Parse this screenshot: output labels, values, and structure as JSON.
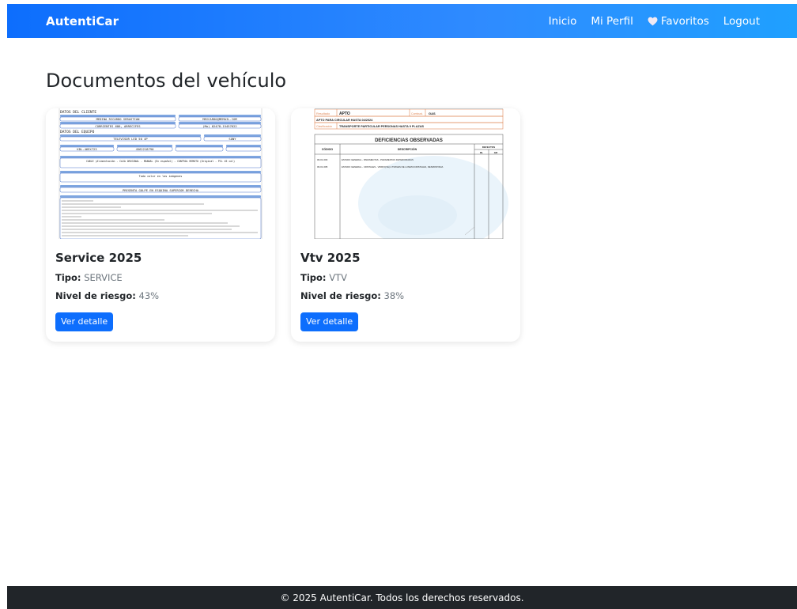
{
  "navbar": {
    "brand": "AutentiCar",
    "links": [
      {
        "label": "Inicio"
      },
      {
        "label": "Mi Perfil"
      },
      {
        "label": "Favoritos"
      },
      {
        "label": "Logout"
      }
    ]
  },
  "page": {
    "title": "Documentos del vehículo"
  },
  "documents": [
    {
      "title": "Service 2025",
      "tipo_label": "Tipo:",
      "tipo": "SERVICE",
      "riesgo_label": "Nivel de riesgo:",
      "riesgo": "43%",
      "button": "Ver detalle",
      "thumb": {
        "section_cliente": "DATOS DEL CLIENTE",
        "cliente_nombre": "MEDINA RICARDO SEBASTIAN",
        "cliente_email": "MRICARDO@MEMAIL.COM",
        "cliente_domicilio": "CORRIENTES 686, ARRECIFES",
        "cliente_telefono": "(Mo) 02478-15457622",
        "section_equipo": "DATOS DEL EQUIPO",
        "equipo_desc": "TELEVISOR LED 50 4P",
        "equipo_marca": "SONY",
        "equipo_modelo": "KDL-46EX723",
        "equipo_serie": "4562218790",
        "accesorios": "CABLE (Alimentación - CAJA ORIGINAL - MANUAL (En español) - CONTROL REMOTO (Original - PIL 45 col)",
        "danos": "Todo color en las imágenes",
        "comentarios": "PRESENTA GOLPE EN ESQUINA SUPERIOR DERECHA"
      }
    },
    {
      "title": "Vtv 2025",
      "tipo_label": "Tipo:",
      "tipo": "VTV",
      "riesgo_label": "Nivel de riesgo:",
      "riesgo": "38%",
      "button": "Ver detalle",
      "thumb": {
        "resultado_label": "Resultado",
        "resultado": "APTO",
        "combustible_label": "Combust.",
        "combustible": "GAS",
        "apto_line": "APTO PARA CIRCULAR HASTA 04/2024",
        "clasificacion_label": "Clasificación",
        "clasificacion": "TRANSPORTE PARTICULAR PERSONAS HASTA 9 PLAZAS",
        "deficiencias_title": "DEFICIENCIAS OBSERVADAS",
        "col_codigo": "CÓDIGO",
        "col_descripcion": "DESCRIPCIÓN",
        "col_defectos": "DEFECTOS",
        "col_rl": "RL",
        "col_gr": "GR",
        "row1_code": "09.01.003",
        "row1_desc": "ESTADO GENERAL - PARAMENTAS - PARAMENTAS DETERIORADAS",
        "row2_code": "09.01.005",
        "row2_desc": "ESTADO GENERAL - CRISTALES - VIDRIO(VE) A TRAVES DE LUNETA/CRISTALES, DESMONTADA"
      }
    }
  ],
  "footer": {
    "text": "© 2025 AutentiCar. Todos los derechos reservados."
  },
  "colors": {
    "primary": "#0d6efd",
    "footer_bg": "#212529",
    "doc_blue": "#4a74c9",
    "vtv_orange": "#e08a5a"
  }
}
